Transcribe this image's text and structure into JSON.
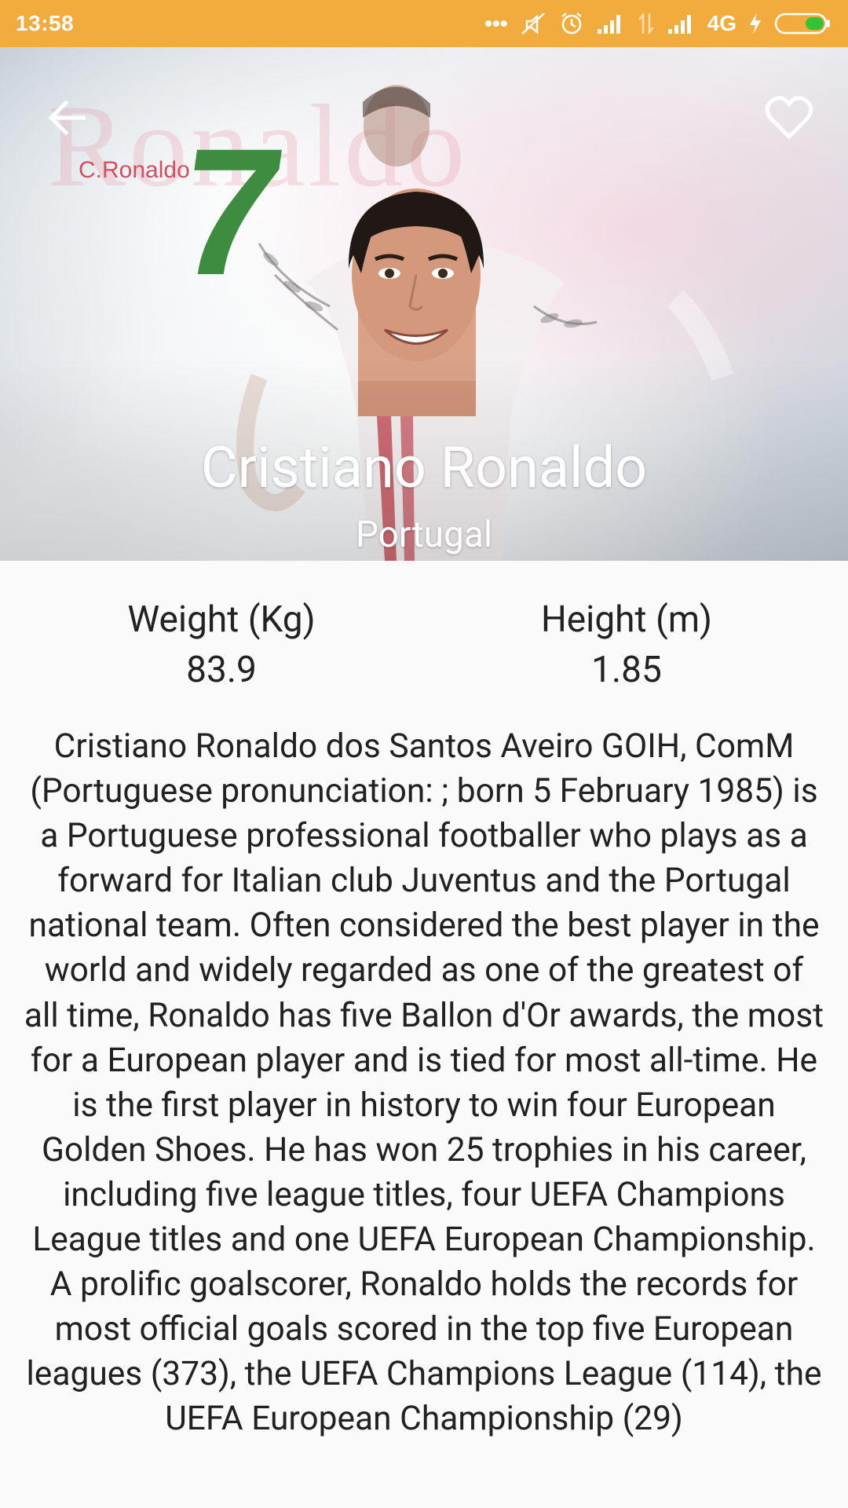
{
  "status_bar": {
    "time": "13:58",
    "network": "4G",
    "icons": [
      "dots-icon",
      "mute-icon",
      "alarm-icon",
      "signal-icon",
      "data-arrows-icon",
      "signal-icon",
      "charging-icon",
      "battery-icon"
    ]
  },
  "hero": {
    "background_text": "Ronaldo",
    "jersey_number": "7",
    "small_label": "C.Ronaldo",
    "back_icon": "arrow-back-icon",
    "favorite_icon": "heart-outline-icon"
  },
  "player": {
    "name": "Cristiano Ronaldo",
    "country": "Portugal"
  },
  "stats": {
    "weight_label": "Weight (Kg)",
    "weight_value": "83.9",
    "height_label": "Height (m)",
    "height_value": "1.85"
  },
  "bio": "Cristiano Ronaldo dos Santos Aveiro GOIH, ComM (Portuguese pronunciation: ; born 5 February 1985) is a Portuguese professional footballer who plays as a forward for Italian club Juventus and the Portugal national team. Often considered the best player in the world and widely regarded as one of the greatest of all time, Ronaldo has five Ballon d'Or awards, the most for a European player and is tied for most all-time. He is the first player in history to win four European Golden Shoes. He has won 25 trophies in his career, including five league titles, four UEFA Champions League titles and one UEFA European Championship. A prolific goalscorer, Ronaldo holds the records for most official goals scored in the top five European leagues (373), the UEFA Champions League (114), the UEFA European Championship (29)",
  "colors": {
    "status_bar": "#f2ab3d",
    "jersey_green": "#3d8c3f",
    "text": "#212121",
    "background": "#fafafa"
  }
}
